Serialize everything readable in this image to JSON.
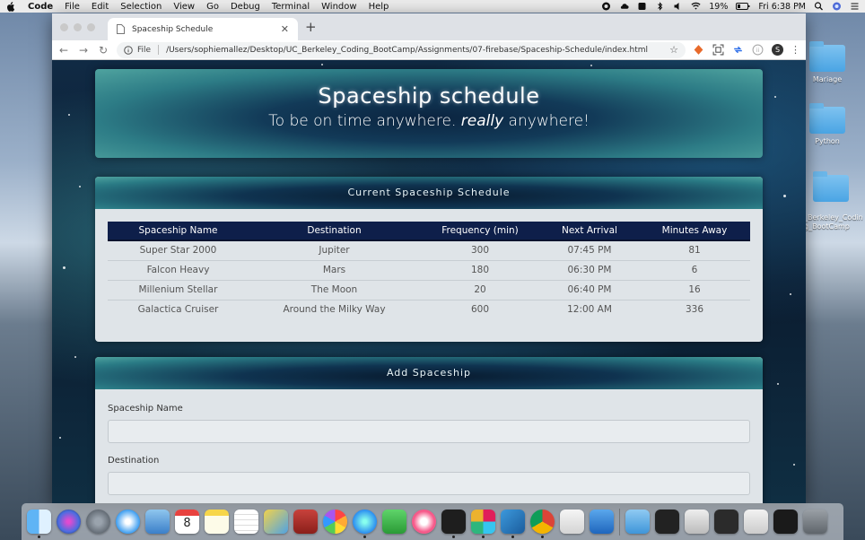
{
  "menubar": {
    "app_name": "Code",
    "items": [
      "File",
      "Edit",
      "Selection",
      "View",
      "Go",
      "Debug",
      "Terminal",
      "Window",
      "Help"
    ],
    "battery": "19%",
    "clock": "Fri 6:38 PM"
  },
  "desktop": {
    "folders": [
      "Mariage",
      "Python",
      "_Berkeley_Codin\ng_BootCamp"
    ]
  },
  "browser": {
    "tab_title": "Spaceship Schedule",
    "file_label": "File",
    "url": "/Users/sophiemallez/Desktop/UC_Berkeley_Coding_BootCamp/Assignments/07-firebase/Spaceship-Schedule/index.html",
    "profile_initial": "S"
  },
  "page": {
    "title": "Spaceship schedule",
    "lead_before": "To be on time anywhere. ",
    "lead_em": "really",
    "lead_after": " anywhere!",
    "schedule_heading": "Current Spaceship Schedule",
    "table": {
      "headers": [
        "Spaceship Name",
        "Destination",
        "Frequency (min)",
        "Next Arrival",
        "Minutes Away"
      ],
      "rows": [
        [
          "Super Star 2000",
          "Jupiter",
          "300",
          "07:45 PM",
          "81"
        ],
        [
          "Falcon Heavy",
          "Mars",
          "180",
          "06:30 PM",
          "6"
        ],
        [
          "Millenium Stellar",
          "The Moon",
          "20",
          "06:40 PM",
          "16"
        ],
        [
          "Galactica Cruiser",
          "Around the Milky Way",
          "600",
          "12:00 AM",
          "336"
        ]
      ]
    },
    "add_heading": "Add Spaceship",
    "form": {
      "name_label": "Spaceship Name",
      "destination_label": "Destination"
    }
  },
  "dock": {
    "apps": [
      "finder",
      "siri",
      "launchpad",
      "safari",
      "mail",
      "calendar",
      "notes",
      "reminders",
      "preview",
      "photobooth",
      "photos",
      "messages",
      "facetime",
      "itunes",
      "terminal",
      "slack",
      "vscode",
      "chrome",
      "textedit",
      "xcode",
      "downloads",
      "desktop-window-1",
      "desktop-window-2",
      "desktop-window-3",
      "desktop-window-4",
      "desktop-window-5",
      "trash"
    ],
    "calendar_day": "8"
  },
  "colors": {
    "table_header": "#0e1f4a",
    "panel_bg": "#dfe4e8",
    "jumbotron_dark": "#0b2440",
    "jumbotron_teal": "#4fa39f"
  }
}
